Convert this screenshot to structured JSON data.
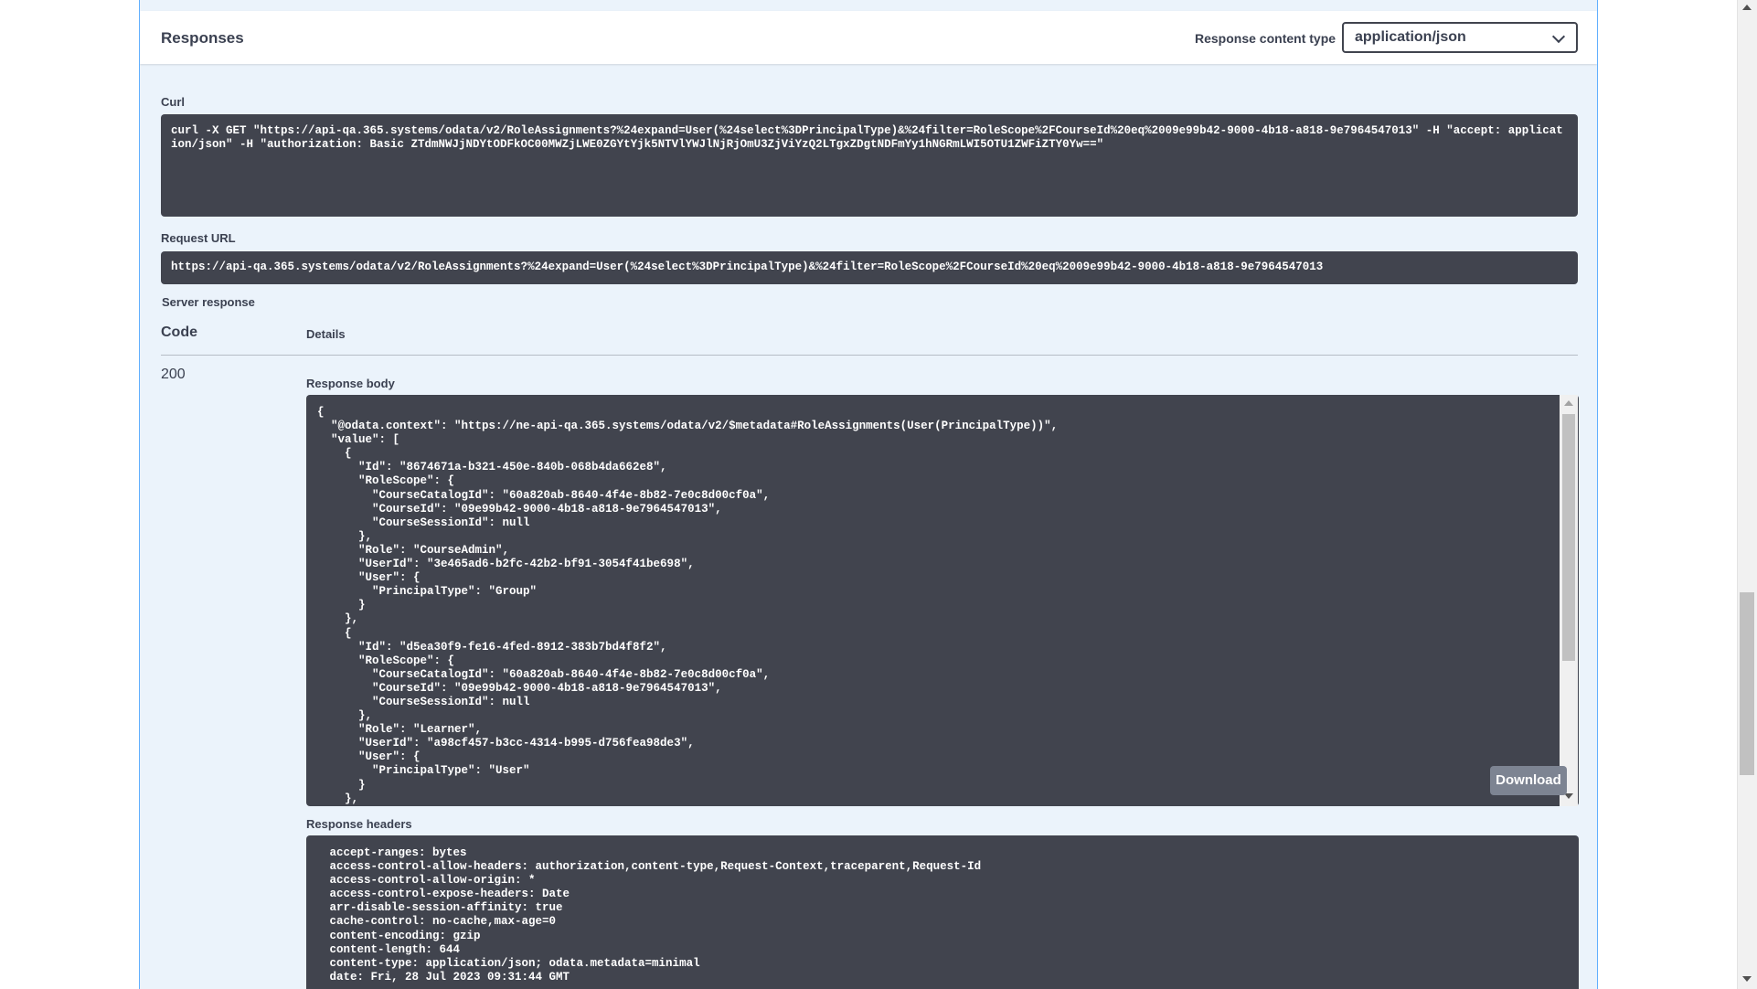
{
  "responses": {
    "title": "Responses",
    "content_type_label": "Response content type",
    "content_type_value": "application/json"
  },
  "curl": {
    "label": "Curl",
    "command": "curl -X GET \"https://api-qa.365.systems/odata/v2/RoleAssignments?%24expand=User(%24select%3DPrincipalType)&%24filter=RoleScope%2FCourseId%20eq%2009e99b42-9000-4b18-a818-9e7964547013\" -H \"accept: application/json\" -H \"authorization: Basic ZTdmNWJjNDYtODFkOC00MWZjLWE0ZGYtYjk5NTVlYWJlNjRjOmU3ZjViYzQ2LTgxZDgtNDFmYy1hNGRmLWI5OTU1ZWFiZTY0Yw==\""
  },
  "request_url": {
    "label": "Request URL",
    "value": "https://api-qa.365.systems/odata/v2/RoleAssignments?%24expand=User(%24select%3DPrincipalType)&%24filter=RoleScope%2FCourseId%20eq%2009e99b42-9000-4b18-a818-9e7964547013"
  },
  "server_response": {
    "label": "Server response",
    "col_code": "Code",
    "col_details": "Details",
    "status_code": "200",
    "body_label": "Response body",
    "body": "{\n  \"@odata.context\": \"https://ne-api-qa.365.systems/odata/v2/$metadata#RoleAssignments(User(PrincipalType))\",\n  \"value\": [\n    {\n      \"Id\": \"8674671a-b321-450e-840b-068b4da662e8\",\n      \"RoleScope\": {\n        \"CourseCatalogId\": \"60a820ab-8640-4f4e-8b82-7e0c8d00cf0a\",\n        \"CourseId\": \"09e99b42-9000-4b18-a818-9e7964547013\",\n        \"CourseSessionId\": null\n      },\n      \"Role\": \"CourseAdmin\",\n      \"UserId\": \"3e465ad6-b2fc-42b2-bf91-3054f41be698\",\n      \"User\": {\n        \"PrincipalType\": \"Group\"\n      }\n    },\n    {\n      \"Id\": \"d5ea30f9-fe16-4fed-8912-383b7bd4f8f2\",\n      \"RoleScope\": {\n        \"CourseCatalogId\": \"60a820ab-8640-4f4e-8b82-7e0c8d00cf0a\",\n        \"CourseId\": \"09e99b42-9000-4b18-a818-9e7964547013\",\n        \"CourseSessionId\": null\n      },\n      \"Role\": \"Learner\",\n      \"UserId\": \"a98cf457-b3cc-4314-b995-d756fea98de3\",\n      \"User\": {\n        \"PrincipalType\": \"User\"\n      }\n    },",
    "download_label": "Download",
    "headers_label": "Response headers",
    "headers": " accept-ranges: bytes\n access-control-allow-headers: authorization,content-type,Request-Context,traceparent,Request-Id\n access-control-allow-origin: *\n access-control-expose-headers: Date\n arr-disable-session-affinity: true\n cache-control: no-cache,max-age=0\n content-encoding: gzip\n content-length: 644\n content-type: application/json; odata.metadata=minimal\n date: Fri, 28 Jul 2023 09:31:44 GMT"
  },
  "icons": {
    "content_type_dropdown": "chevron-down-icon",
    "scroll_up": "arrow-up-icon",
    "scroll_down": "arrow-down-icon"
  },
  "colors": {
    "panel_background": "#ebf3fb",
    "panel_border": "#61affe",
    "code_background": "#41444e",
    "download_button": "#7d8492"
  }
}
